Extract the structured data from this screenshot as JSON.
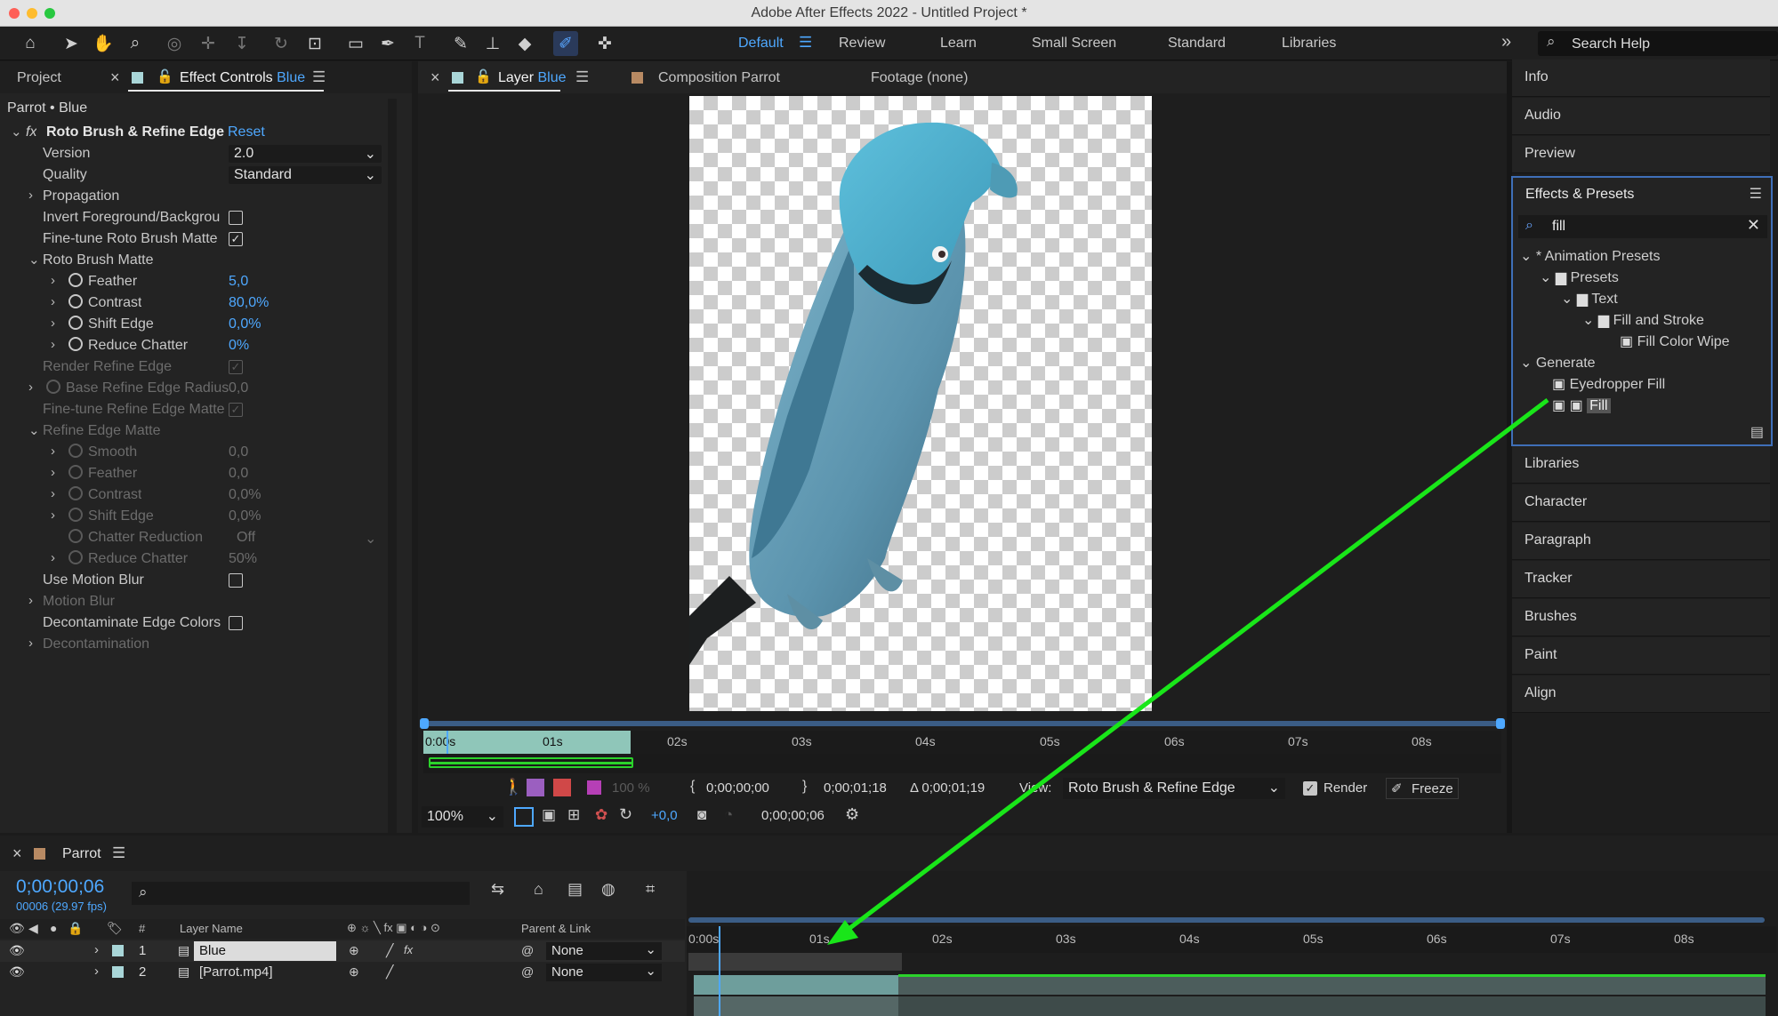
{
  "window": {
    "title": "Adobe After Effects 2022 - Untitled Project *"
  },
  "workspaces": {
    "items": [
      "Default",
      "Review",
      "Learn",
      "Small Screen",
      "Standard",
      "Libraries"
    ],
    "active": "Default"
  },
  "search_help": {
    "placeholder": "Search Help"
  },
  "left_panel": {
    "tab_project": "Project",
    "tab_effect_controls": "Effect Controls",
    "tab_effect_controls_layer": "Blue",
    "breadcrumb": "Parrot • Blue",
    "effect": {
      "name": "Roto Brush & Refine Edge",
      "reset": "Reset",
      "version_label": "Version",
      "version_value": "2.0",
      "quality_label": "Quality",
      "quality_value": "Standard",
      "propagation": "Propagation",
      "invert": "Invert Foreground/Backgrou",
      "finetune_roto": "Fine-tune Roto Brush Matte",
      "roto_brush_matte": "Roto Brush Matte",
      "feather_label": "Feather",
      "feather_value": "5,0",
      "contrast_label": "Contrast",
      "contrast_value": "80,0%",
      "shift_label": "Shift Edge",
      "shift_value": "0,0%",
      "reduce_label": "Reduce Chatter",
      "reduce_value": "0%",
      "render_refine": "Render Refine Edge",
      "base_radius_label": "Base Refine Edge Radius",
      "base_radius_value": "0,0",
      "finetune_refine": "Fine-tune Refine Edge Matte",
      "refine_edge_matte": "Refine Edge Matte",
      "smooth_label": "Smooth",
      "smooth_value": "0,0",
      "feather2_label": "Feather",
      "feather2_value": "0,0",
      "contrast2_label": "Contrast",
      "contrast2_value": "0,0%",
      "shift2_label": "Shift Edge",
      "shift2_value": "0,0%",
      "chatter_label": "Chatter Reduction",
      "chatter_value": "Off",
      "reduce2_label": "Reduce Chatter",
      "reduce2_value": "50%",
      "motion_blur_use": "Use Motion Blur",
      "motion_blur": "Motion Blur",
      "decontam_colors": "Decontaminate Edge Colors",
      "decontamination": "Decontamination"
    }
  },
  "viewer": {
    "tab_layer": "Layer",
    "tab_layer_name": "Blue",
    "tab_composition": "Composition Parrot",
    "tab_footage": "Footage (none)",
    "ruler": [
      "0:00s",
      "01s",
      "02s",
      "03s",
      "04s",
      "05s",
      "06s",
      "07s",
      "08s"
    ],
    "in_time": "0;00;00;00",
    "out_time": "0;00;01;18",
    "duration": "Δ 0;00;01;19",
    "view_label": "View:",
    "view_value": "Roto Brush & Refine Edge",
    "render_label": "Render",
    "freeze_label": "Freeze",
    "opacity": "100 %",
    "zoom": "100%",
    "exposure": "+0,0",
    "current_time": "0;00;00;06"
  },
  "right_panels": {
    "top": [
      "Info",
      "Audio",
      "Preview"
    ],
    "effects_presets_title": "Effects & Presets",
    "search_value": "fill",
    "tree": {
      "animation_presets": "* Animation Presets",
      "presets": "Presets",
      "text": "Text",
      "fill_and_stroke": "Fill and Stroke",
      "fill_color_wipe": "Fill Color Wipe",
      "generate": "Generate",
      "eyedropper_fill": "Eyedropper Fill",
      "fill": "Fill"
    },
    "bottom": [
      "Libraries",
      "Character",
      "Paragraph",
      "Tracker",
      "Brushes",
      "Paint",
      "Align"
    ]
  },
  "timeline": {
    "comp_name": "Parrot",
    "current_time": "0;00;00;06",
    "frame_info": "00006 (29.97 fps)",
    "ruler": [
      "0:00s",
      "01s",
      "02s",
      "03s",
      "04s",
      "05s",
      "06s",
      "07s",
      "08s"
    ],
    "col_num": "#",
    "col_layer_name": "Layer Name",
    "col_parent": "Parent & Link",
    "layers": [
      {
        "index": "1",
        "name": "Blue",
        "parent": "None"
      },
      {
        "index": "2",
        "name": "[Parrot.mp4]",
        "parent": "None"
      }
    ]
  },
  "colors": {
    "accent": "#4ea8ff",
    "annotation_arrow": "#19e619",
    "panel": "#232323"
  }
}
